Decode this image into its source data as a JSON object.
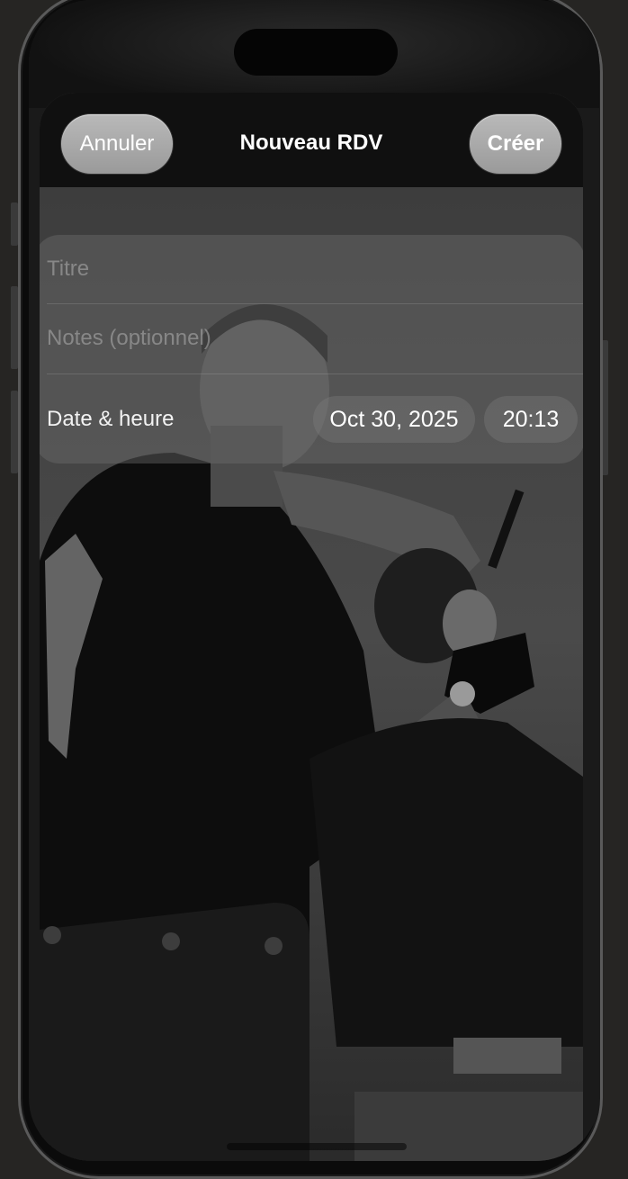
{
  "navbar": {
    "cancel_label": "Annuler",
    "title": "Nouveau RDV",
    "create_label": "Créer"
  },
  "form": {
    "title_placeholder": "Titre",
    "notes_placeholder": "Notes (optionnel)",
    "date_label": "Date & heure",
    "date_value": "Oct 30, 2025",
    "time_value": "20:13"
  },
  "background": {
    "image": "barber-cutting-hair-photo"
  },
  "colors": {
    "navbar_bg": "#101010",
    "button_bg": "#a8a8a8",
    "text": "#ffffff"
  }
}
